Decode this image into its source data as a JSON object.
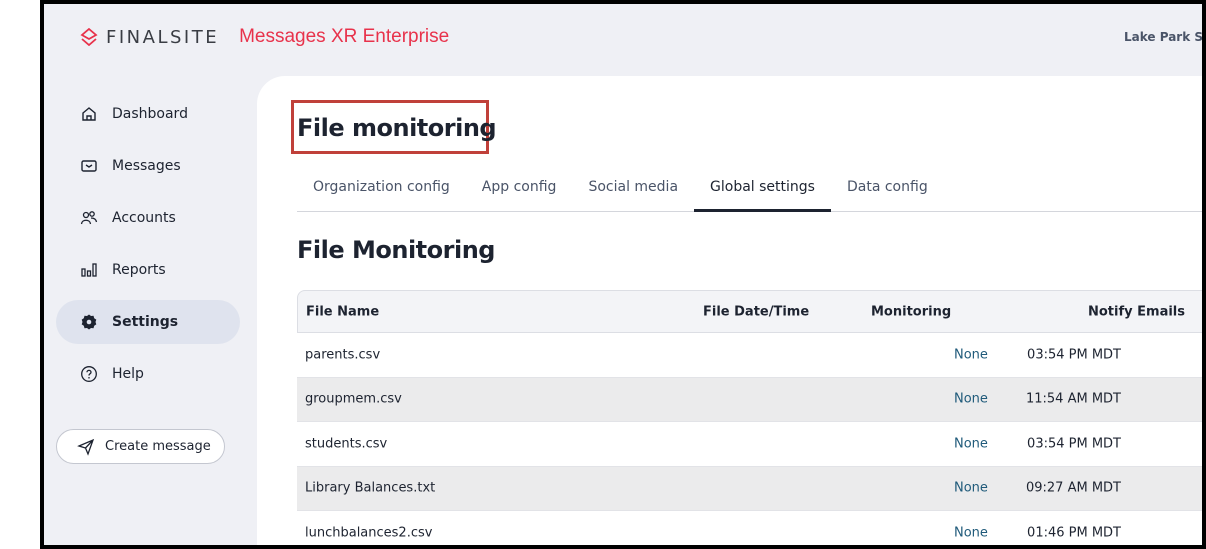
{
  "brand": {
    "name": "FINALSITE",
    "product": "Messages XR Enterprise",
    "accent": "#e8324b"
  },
  "org": "Lake Park S",
  "sidebar": {
    "items": [
      {
        "label": "Dashboard",
        "icon": "home-icon"
      },
      {
        "label": "Messages",
        "icon": "mail-icon"
      },
      {
        "label": "Accounts",
        "icon": "users-icon"
      },
      {
        "label": "Reports",
        "icon": "bar-chart-icon"
      },
      {
        "label": "Settings",
        "icon": "gear-icon",
        "active": true
      },
      {
        "label": "Help",
        "icon": "help-icon"
      }
    ],
    "create": "Create message"
  },
  "page": {
    "title": "File monitoring",
    "section": "File Monitoring",
    "tabs": [
      "Organization config",
      "App config",
      "Social media",
      "Global settings",
      "Data config"
    ],
    "active_tab": "Global settings"
  },
  "table": {
    "headers": [
      "File Name",
      "File Date/Time",
      "Monitoring",
      "Notify Emails"
    ],
    "rows": [
      [
        "parents.csv",
        "03:54 PM MDT",
        "None",
        ""
      ],
      [
        "groupmem.csv",
        "11:54 AM MDT",
        "None",
        ""
      ],
      [
        "students.csv",
        "03:54 PM MDT",
        "None",
        ""
      ],
      [
        "Library Balances.txt",
        "09:27 AM MDT",
        "None",
        ""
      ],
      [
        "lunchbalances2.csv",
        "01:46 PM MDT",
        "None",
        ""
      ]
    ]
  }
}
